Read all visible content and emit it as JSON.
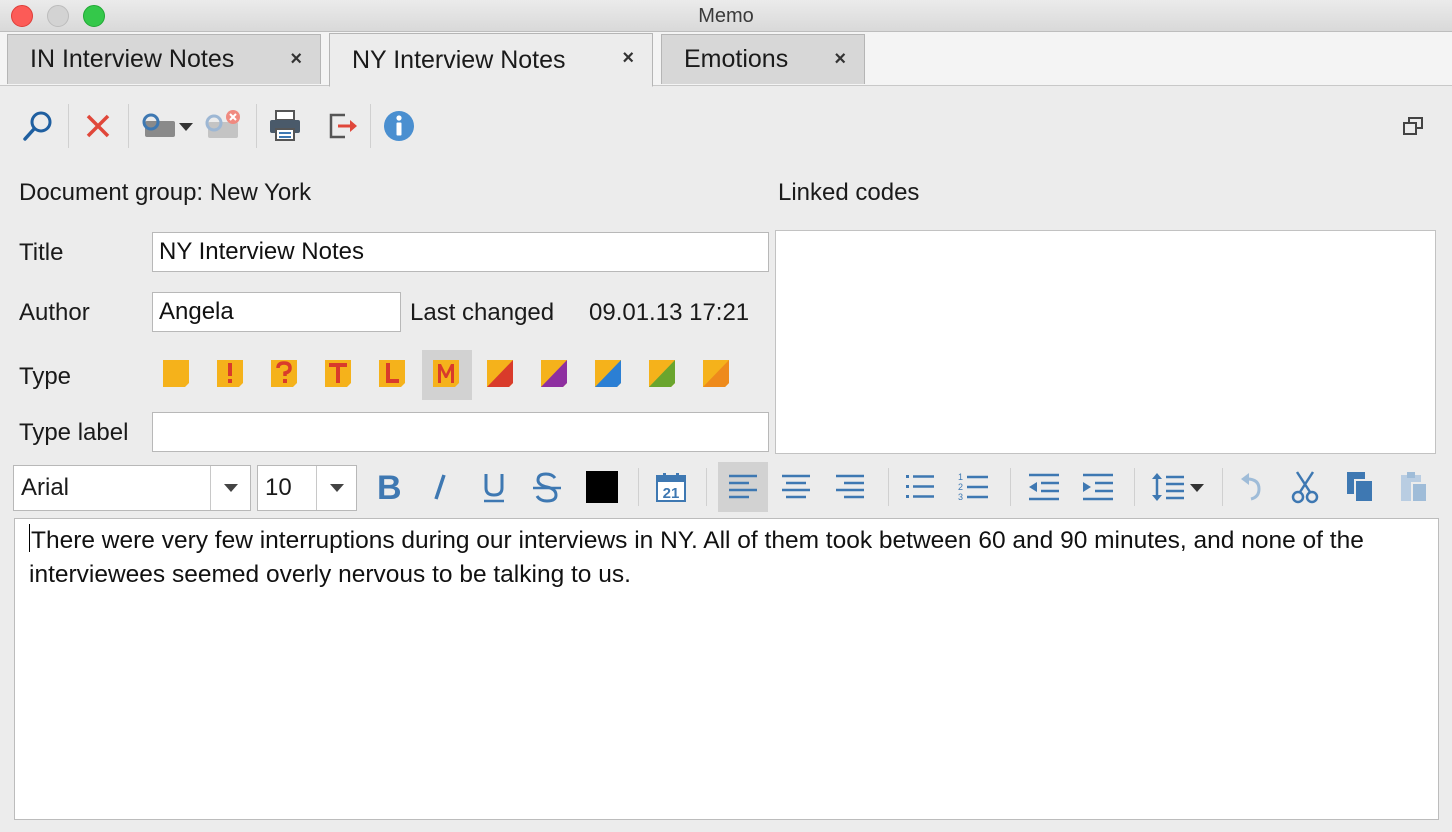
{
  "window": {
    "title": "Memo"
  },
  "tabs": [
    {
      "label": "IN Interview Notes",
      "close": "×"
    },
    {
      "label": "NY Interview Notes",
      "close": "×"
    },
    {
      "label": "Emotions",
      "close": "×"
    }
  ],
  "toolbar": {
    "icons": [
      "search-icon",
      "delete-icon",
      "link-code-icon",
      "unlink-code-icon",
      "print-icon",
      "export-icon",
      "info-icon",
      "detach-window-icon"
    ]
  },
  "form": {
    "document_group": "Document group: New York",
    "linked_codes_label": "Linked codes",
    "title_label": "Title",
    "title_value": "NY Interview Notes",
    "author_label": "Author",
    "author_value": "Angela",
    "last_changed_label": "Last changed",
    "last_changed_value": "09.01.13 17:21",
    "type_label": "Type",
    "type_label_label": "Type label",
    "type_label_value": "",
    "selected_type": "M",
    "types": [
      {
        "name": "plain",
        "glyph": ""
      },
      {
        "name": "exclamation",
        "glyph": "!"
      },
      {
        "name": "question",
        "glyph": "?"
      },
      {
        "name": "T",
        "glyph": "T"
      },
      {
        "name": "L",
        "glyph": "L"
      },
      {
        "name": "M",
        "glyph": "M"
      },
      {
        "name": "red",
        "glyph": ""
      },
      {
        "name": "purple",
        "glyph": ""
      },
      {
        "name": "blue",
        "glyph": ""
      },
      {
        "name": "green",
        "glyph": ""
      },
      {
        "name": "orange",
        "glyph": ""
      }
    ]
  },
  "format": {
    "font": "Arial",
    "size": "10",
    "text_color": "#000000",
    "date_icon_text": "21"
  },
  "colors": {
    "type_yellow": "#f5b21b",
    "type_red": "#d93b2b",
    "type_purple": "#8e2fa0",
    "type_blue": "#2b7fd4",
    "type_green": "#6aa52e",
    "type_orange": "#ee8a1c",
    "icon_blue": "#3e78b2"
  },
  "editor": {
    "text": "There were very few interruptions during our interviews in NY. All of them took between 60 and 90 minutes, and none of the interviewees seemed overly nervous to be talking to us."
  }
}
